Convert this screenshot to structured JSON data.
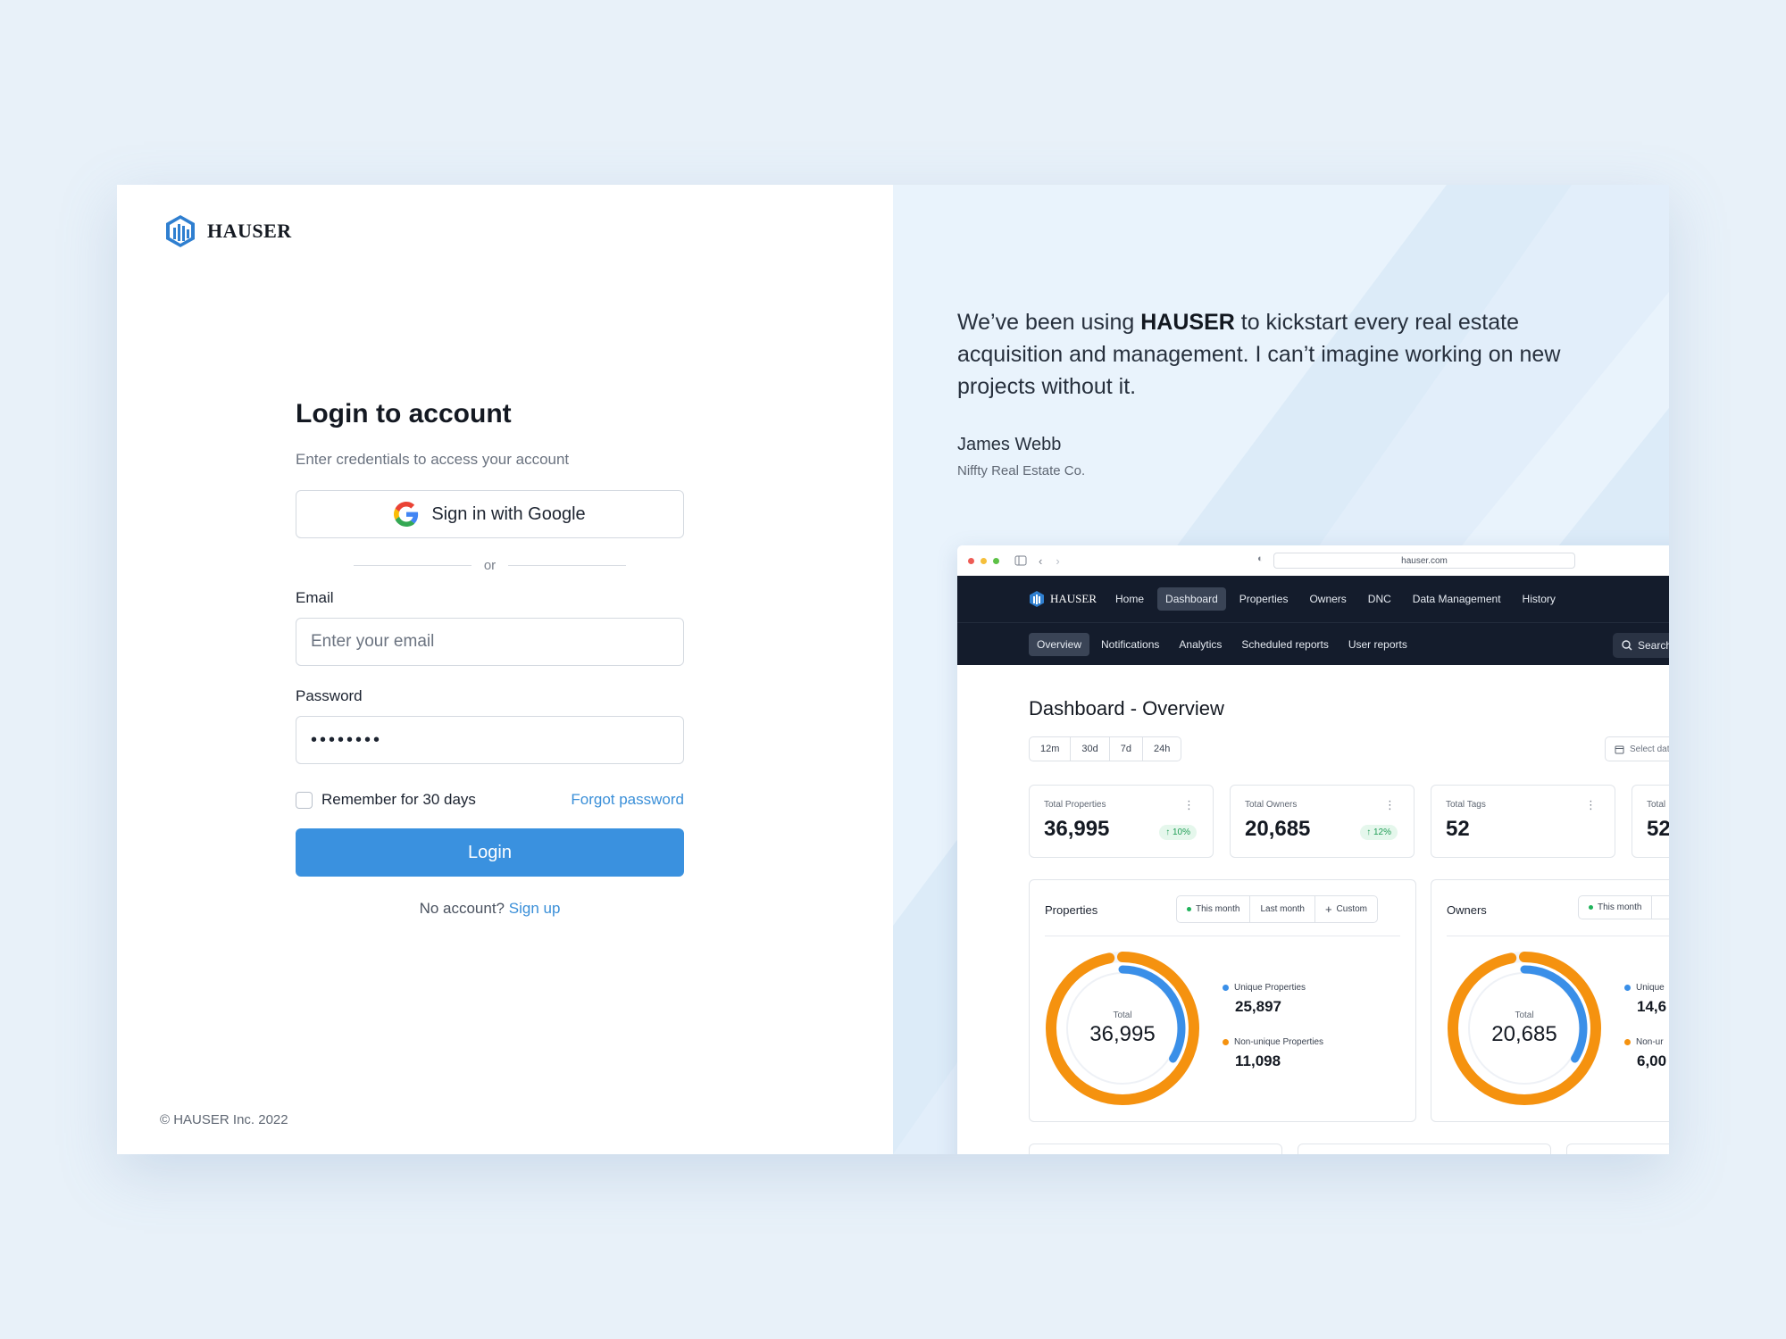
{
  "brand": {
    "name": "HAUSER",
    "copyright": "© HAUSER Inc. 2022"
  },
  "login": {
    "title": "Login to account",
    "subtitle": "Enter credentials to access your account",
    "google_label": "Sign in with Google",
    "divider": "or",
    "email_label": "Email",
    "email_placeholder": "Enter your email",
    "password_label": "Password",
    "password_value": "••••••••",
    "remember_label": "Remember for 30 days",
    "forgot_label": "Forgot password",
    "login_label": "Login",
    "no_account": "No account?",
    "signup_label": "Sign up"
  },
  "testimonial": {
    "quote_pre": "We’ve been using ",
    "quote_brand": "HAUSER",
    "quote_post": " to kickstart every real estate acquisition and management. I can’t imagine working on new projects without it.",
    "author": "James Webb",
    "company": "Niffty Real Estate Co."
  },
  "preview": {
    "url": "hauser.com",
    "nav": [
      "Home",
      "Dashboard",
      "Properties",
      "Owners",
      "DNC",
      "Data Management",
      "History"
    ],
    "nav_active": "Dashboard",
    "subnav": [
      "Overview",
      "Notifications",
      "Analytics",
      "Scheduled reports",
      "User reports"
    ],
    "subnav_active": "Overview",
    "search_label": "Search",
    "title": "Dashboard - Overview",
    "ranges": [
      "12m",
      "30d",
      "7d",
      "24h"
    ],
    "select_label": "Select dates",
    "stats": [
      {
        "label": "Total Properties",
        "value": "36,995",
        "change": "↑ 10%"
      },
      {
        "label": "Total Owners",
        "value": "20,685",
        "change": "↑ 12%"
      },
      {
        "label": "Total Tags",
        "value": "52",
        "change": ""
      },
      {
        "label": "Total",
        "value": "52",
        "change": ""
      }
    ],
    "properties": {
      "title": "Properties",
      "tabs": [
        "This month",
        "Last month",
        "Custom"
      ],
      "total_label": "Total",
      "total": "36,995",
      "legend": [
        {
          "label": "Unique Properties",
          "value": "25,897",
          "color": "#3a8fe8"
        },
        {
          "label": "Non-unique Properties",
          "value": "11,098",
          "color": "#f5920f"
        }
      ],
      "unique_share": 0.7,
      "nonunique_share": 0.3
    },
    "owners": {
      "title": "Owners",
      "tabs": [
        "This month"
      ],
      "total_label": "Total",
      "total": "20,685",
      "legend": [
        {
          "label": "Unique",
          "value": "14,6",
          "color": "#3a8fe8"
        },
        {
          "label": "Non-ur",
          "value": "6,00",
          "color": "#f5920f"
        }
      ]
    }
  },
  "colors": {
    "accent": "#3a91df",
    "panel_bg": "#e9f3fc",
    "nav_dark": "#141c2c"
  }
}
